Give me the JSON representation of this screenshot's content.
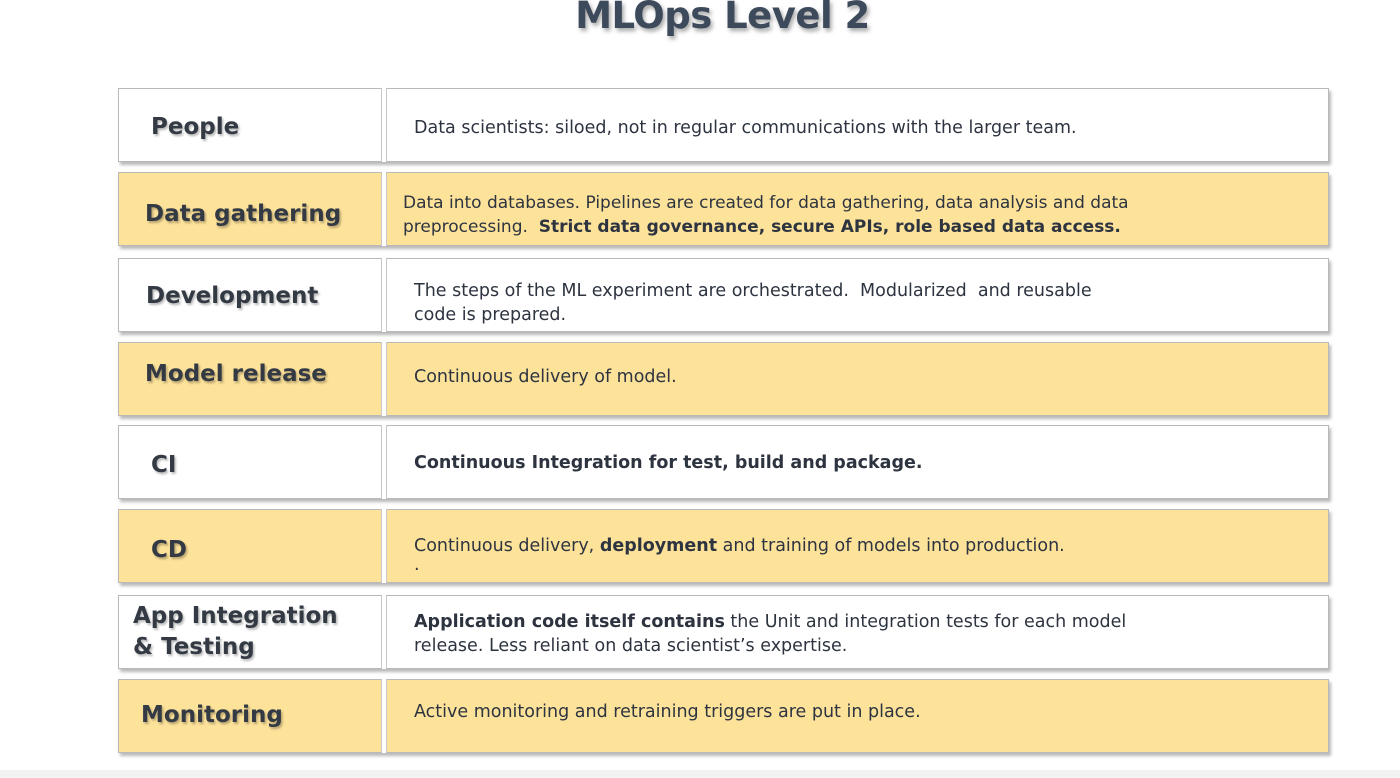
{
  "title": "MLOps Level 2",
  "rows": [
    {
      "label": "People",
      "desc_line1": "Data scientists: siloed, not in regular communications with the larger team."
    },
    {
      "label": "Data gathering",
      "desc_line1": "Data into databases. Pipelines are created for data gathering, data analysis and data",
      "desc_line2_plain": "preprocessing.  ",
      "desc_line2_bold": "Strict data governance, secure APIs, role based data access."
    },
    {
      "label": "Development",
      "desc_line1": "The steps of the ML experiment are orchestrated.  Modularized  and reusable",
      "desc_line2": "code is prepared."
    },
    {
      "label": "Model release",
      "desc_line1": "Continuous delivery of model."
    },
    {
      "label": "CI",
      "desc_line1_bold": "Continuous Integration for test, build and package."
    },
    {
      "label": "CD",
      "desc_line1_plain_a": "Continuous delivery, ",
      "desc_line1_bold": "deployment",
      "desc_line1_plain_b": " and training of models into production.",
      "desc_line2": "."
    },
    {
      "label_line1": "App Integration",
      "label_line2": "& Testing",
      "desc_line1_bold": "Application code itself contains",
      "desc_line1_plain": " the Unit and integration tests for each model",
      "desc_line2": "release. Less reliant on data scientist’s expertise."
    },
    {
      "label": "Monitoring",
      "desc_line1": "Active monitoring and retraining triggers are put in place."
    }
  ],
  "colors": {
    "yellow_row": "#fde29a",
    "white_row": "#ffffff",
    "title_text": "#3d4a5c"
  }
}
